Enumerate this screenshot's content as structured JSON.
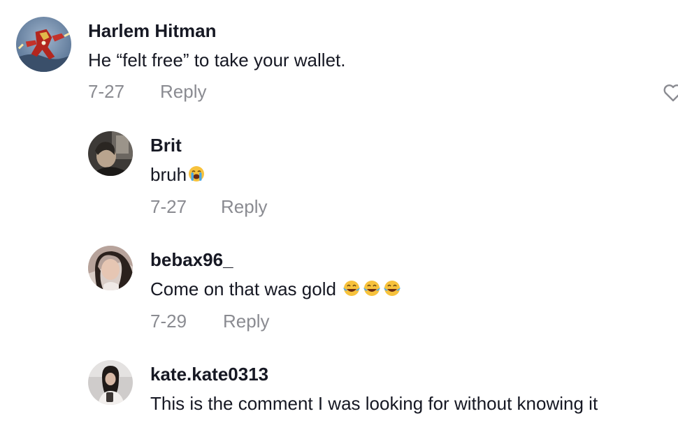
{
  "comments": [
    {
      "username": "Harlem Hitman",
      "text": "He “felt free” to take your wallet.",
      "date": "7-27",
      "reply_label": "Reply",
      "avatar_icon": "iron-man-avatar"
    },
    {
      "username": "Brit",
      "text": "bruh",
      "emoji": [
        "loudly-crying-face"
      ],
      "date": "7-27",
      "reply_label": "Reply",
      "avatar_icon": "user-photo-avatar"
    },
    {
      "username": "bebax96_",
      "text": "Come on that was gold ",
      "emoji": [
        "face-with-tears-of-joy",
        "face-with-tears-of-joy",
        "face-with-tears-of-joy"
      ],
      "date": "7-29",
      "reply_label": "Reply",
      "avatar_icon": "user-photo-avatar"
    },
    {
      "username": "kate.kate0313",
      "text": "This is the comment I was looking for without knowing it",
      "avatar_icon": "user-photo-avatar"
    }
  ],
  "colors": {
    "text": "#161823",
    "secondary": "#8a8b91",
    "emoji_yellow": "#f7c23c",
    "tear_blue": "#49a7e8"
  }
}
